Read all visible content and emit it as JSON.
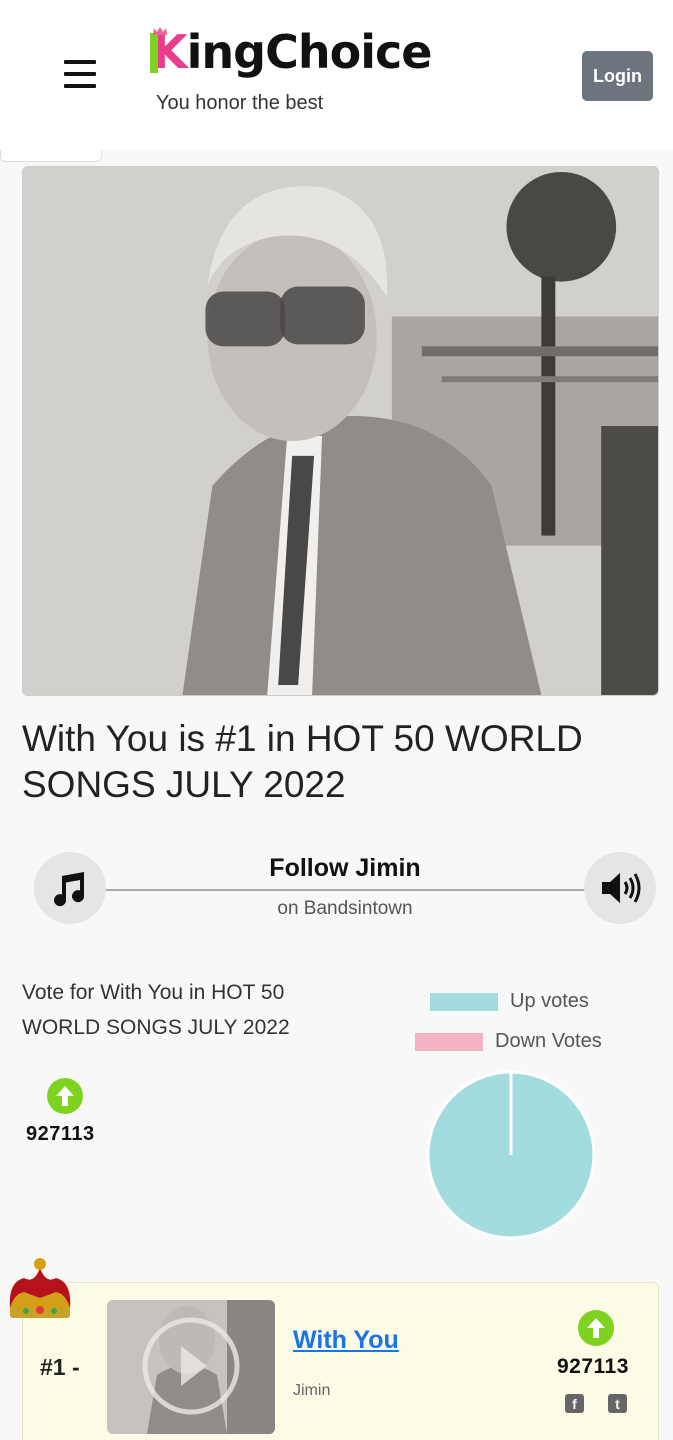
{
  "header": {
    "logo_first": "K",
    "logo_rest": "ingChoice",
    "tagline": "You honor the best",
    "login_label": "Login"
  },
  "hero": {
    "image_icon": "artist-photo"
  },
  "page": {
    "title": "With You is #1 in HOT 50 WORLD SONGS JULY 2022"
  },
  "follow": {
    "title": "Follow Jimin",
    "subtitle": "on Bandsintown",
    "left_icon": "music-note-icon",
    "right_icon": "speaker-icon"
  },
  "vote": {
    "text": "Vote for With You in HOT 50 WORLD SONGS JULY 2022",
    "count": "927113"
  },
  "chart_data": {
    "type": "pie",
    "legend": [
      "Up votes",
      "Down Votes"
    ],
    "values": [
      927113,
      0
    ],
    "colors": [
      "#a3dcdf",
      "#f4b3c2"
    ]
  },
  "ranking": {
    "rank": "#1 -",
    "song": "With You",
    "artist": "Jimin",
    "count": "927113"
  },
  "colors": {
    "accent_green": "#7ed321",
    "brand_pink": "#e83e8c",
    "login_gray": "#6c757d",
    "link_blue": "#1a73e8"
  }
}
